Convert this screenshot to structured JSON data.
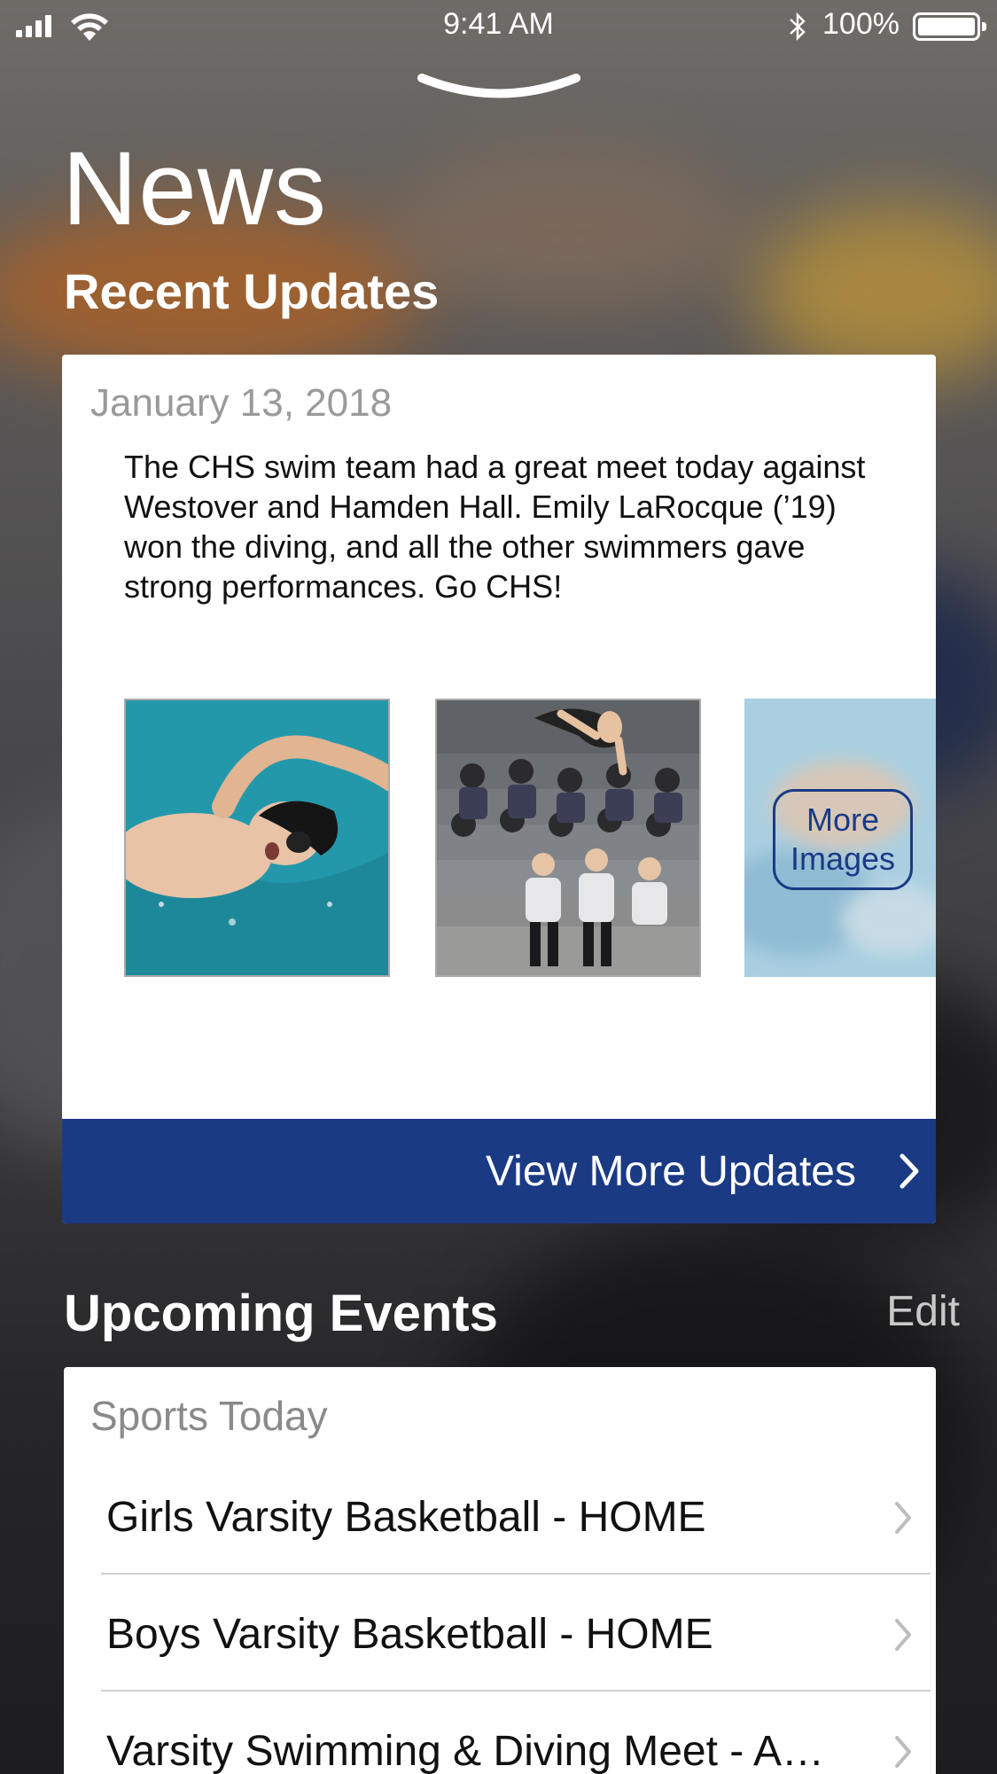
{
  "status_bar": {
    "time": "9:41 AM",
    "battery_text": "100%"
  },
  "page": {
    "title": "News"
  },
  "recent_updates": {
    "section_title": "Recent Updates",
    "post": {
      "date": "January 13, 2018",
      "body": "The CHS swim team had a great meet today against Westover and Hamden Hall. Emily LaRocque (’19) won the diving, and all the other swimmers gave strong performances. Go CHS!",
      "images": [
        "swimmer-photo",
        "diver-photo"
      ],
      "more_images_label": "More Images"
    },
    "view_more_label": "View More Updates"
  },
  "upcoming_events": {
    "section_title": "Upcoming Events",
    "edit_label": "Edit",
    "group_label": "Sports Today",
    "items": [
      {
        "label": "Girls Varsity Basketball - HOME"
      },
      {
        "label": "Boys Varsity Basketball - HOME"
      },
      {
        "label": "Varsity Swimming & Diving Meet - A…"
      }
    ]
  },
  "colors": {
    "brand_blue": "#1b3a84",
    "card_bg": "#ffffff",
    "muted_text": "#9a9a9a"
  },
  "icons": {
    "chevron": "chevron-right-icon",
    "grabber": "chevron-down-icon"
  }
}
